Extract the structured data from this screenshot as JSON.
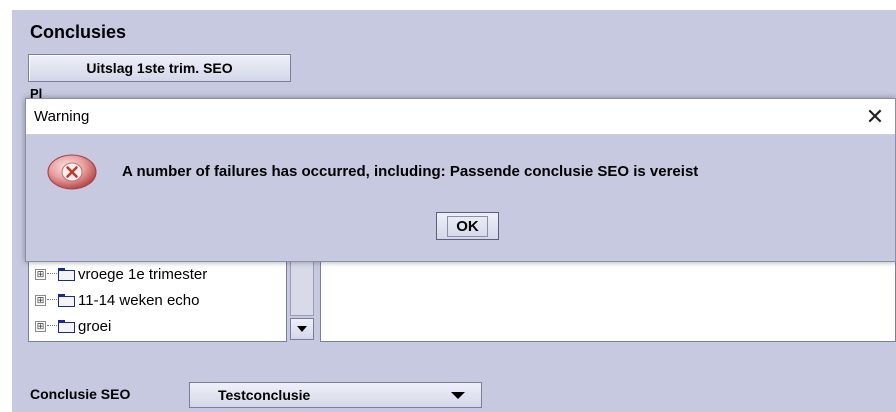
{
  "section": {
    "title": "Conclusies",
    "uitslag_button_label": "Uitslag 1ste trim. SEO",
    "partially_hidden_label": "Pl"
  },
  "tree": {
    "items": [
      {
        "label": "vroege 1e trimester",
        "icon": "folder-icon",
        "expander": "⊞"
      },
      {
        "label": "11-14 weken echo",
        "icon": "folder-icon",
        "expander": "⊞"
      },
      {
        "label": "groei",
        "icon": "folder-icon",
        "expander": "⊞"
      }
    ]
  },
  "conclusie": {
    "label": "Conclusie SEO",
    "selected_value": "Testconclusie"
  },
  "dialog": {
    "title": "Warning",
    "close_glyph": "✕",
    "message": "A number of failures has occurred, including: Passende conclusie SEO is vereist",
    "ok_label": "OK",
    "icon": "error-icon"
  },
  "colors": {
    "panel_background": "#c6c9e0",
    "folder_accent": "#1b2a8a",
    "error_red": "#d9534f"
  }
}
